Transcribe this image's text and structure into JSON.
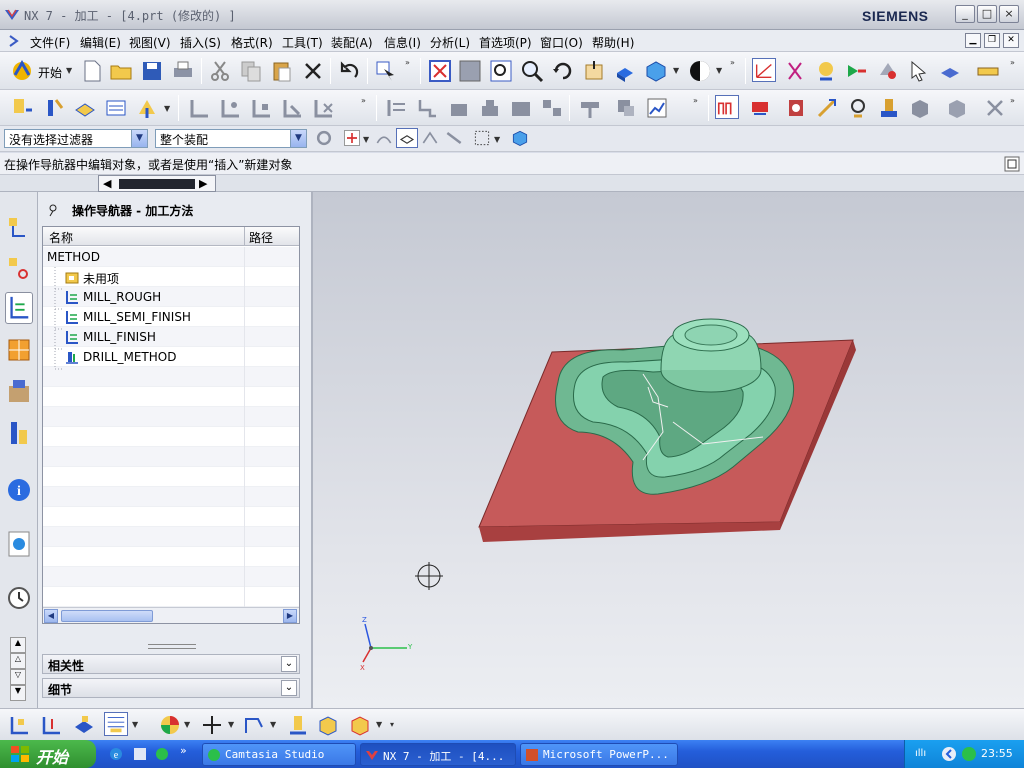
{
  "window": {
    "title": "NX 7 - 加工 - [4.prt (修改的) ]",
    "brand": "SIEMENS",
    "controls": [
      "_",
      "□",
      "×"
    ]
  },
  "menu": [
    "文件(F)",
    "编辑(E)",
    "视图(V)",
    "插入(S)",
    "格式(R)",
    "工具(T)",
    "装配(A)",
    "信息(I)",
    "分析(L)",
    "首选项(P)",
    "窗口(O)",
    "帮助(H)"
  ],
  "toolbar": {
    "start_label": "开始"
  },
  "filter": {
    "selection_filter": "没有选择过滤器",
    "assembly_scope": "整个装配"
  },
  "cue_line": "在操作导航器中编辑对象，或者是使用“插入”新建对象",
  "navigator": {
    "title": "操作导航器 - 加工方法",
    "columns": [
      "名称",
      "路径"
    ],
    "rows": [
      {
        "name": "METHOD",
        "indent": 0,
        "icon": "root"
      },
      {
        "name": "未用项",
        "indent": 1,
        "icon": "folder-icon"
      },
      {
        "name": "MILL_ROUGH",
        "indent": 1,
        "icon": "mill-method-icon"
      },
      {
        "name": "MILL_SEMI_FINISH",
        "indent": 1,
        "icon": "mill-method-icon"
      },
      {
        "name": "MILL_FINISH",
        "indent": 1,
        "icon": "mill-method-icon"
      },
      {
        "name": "DRILL_METHOD",
        "indent": 1,
        "icon": "drill-method-icon"
      }
    ],
    "panels": [
      "相关性",
      "细节"
    ]
  },
  "triad_labels": {
    "x": "X",
    "y": "Y",
    "z": "Z"
  },
  "taskbar": {
    "start": "开始",
    "tasks": [
      "Camtasia Studio",
      "NX 7 - 加工 - [4...",
      "Microsoft PowerP..."
    ],
    "active_task_index": 1,
    "clock": "23:55"
  },
  "colors": {
    "part": "#7ec8a2",
    "stock_plate": "#c65a5a",
    "background_top": "#c5c9d3",
    "background_bottom": "#eceef2"
  }
}
